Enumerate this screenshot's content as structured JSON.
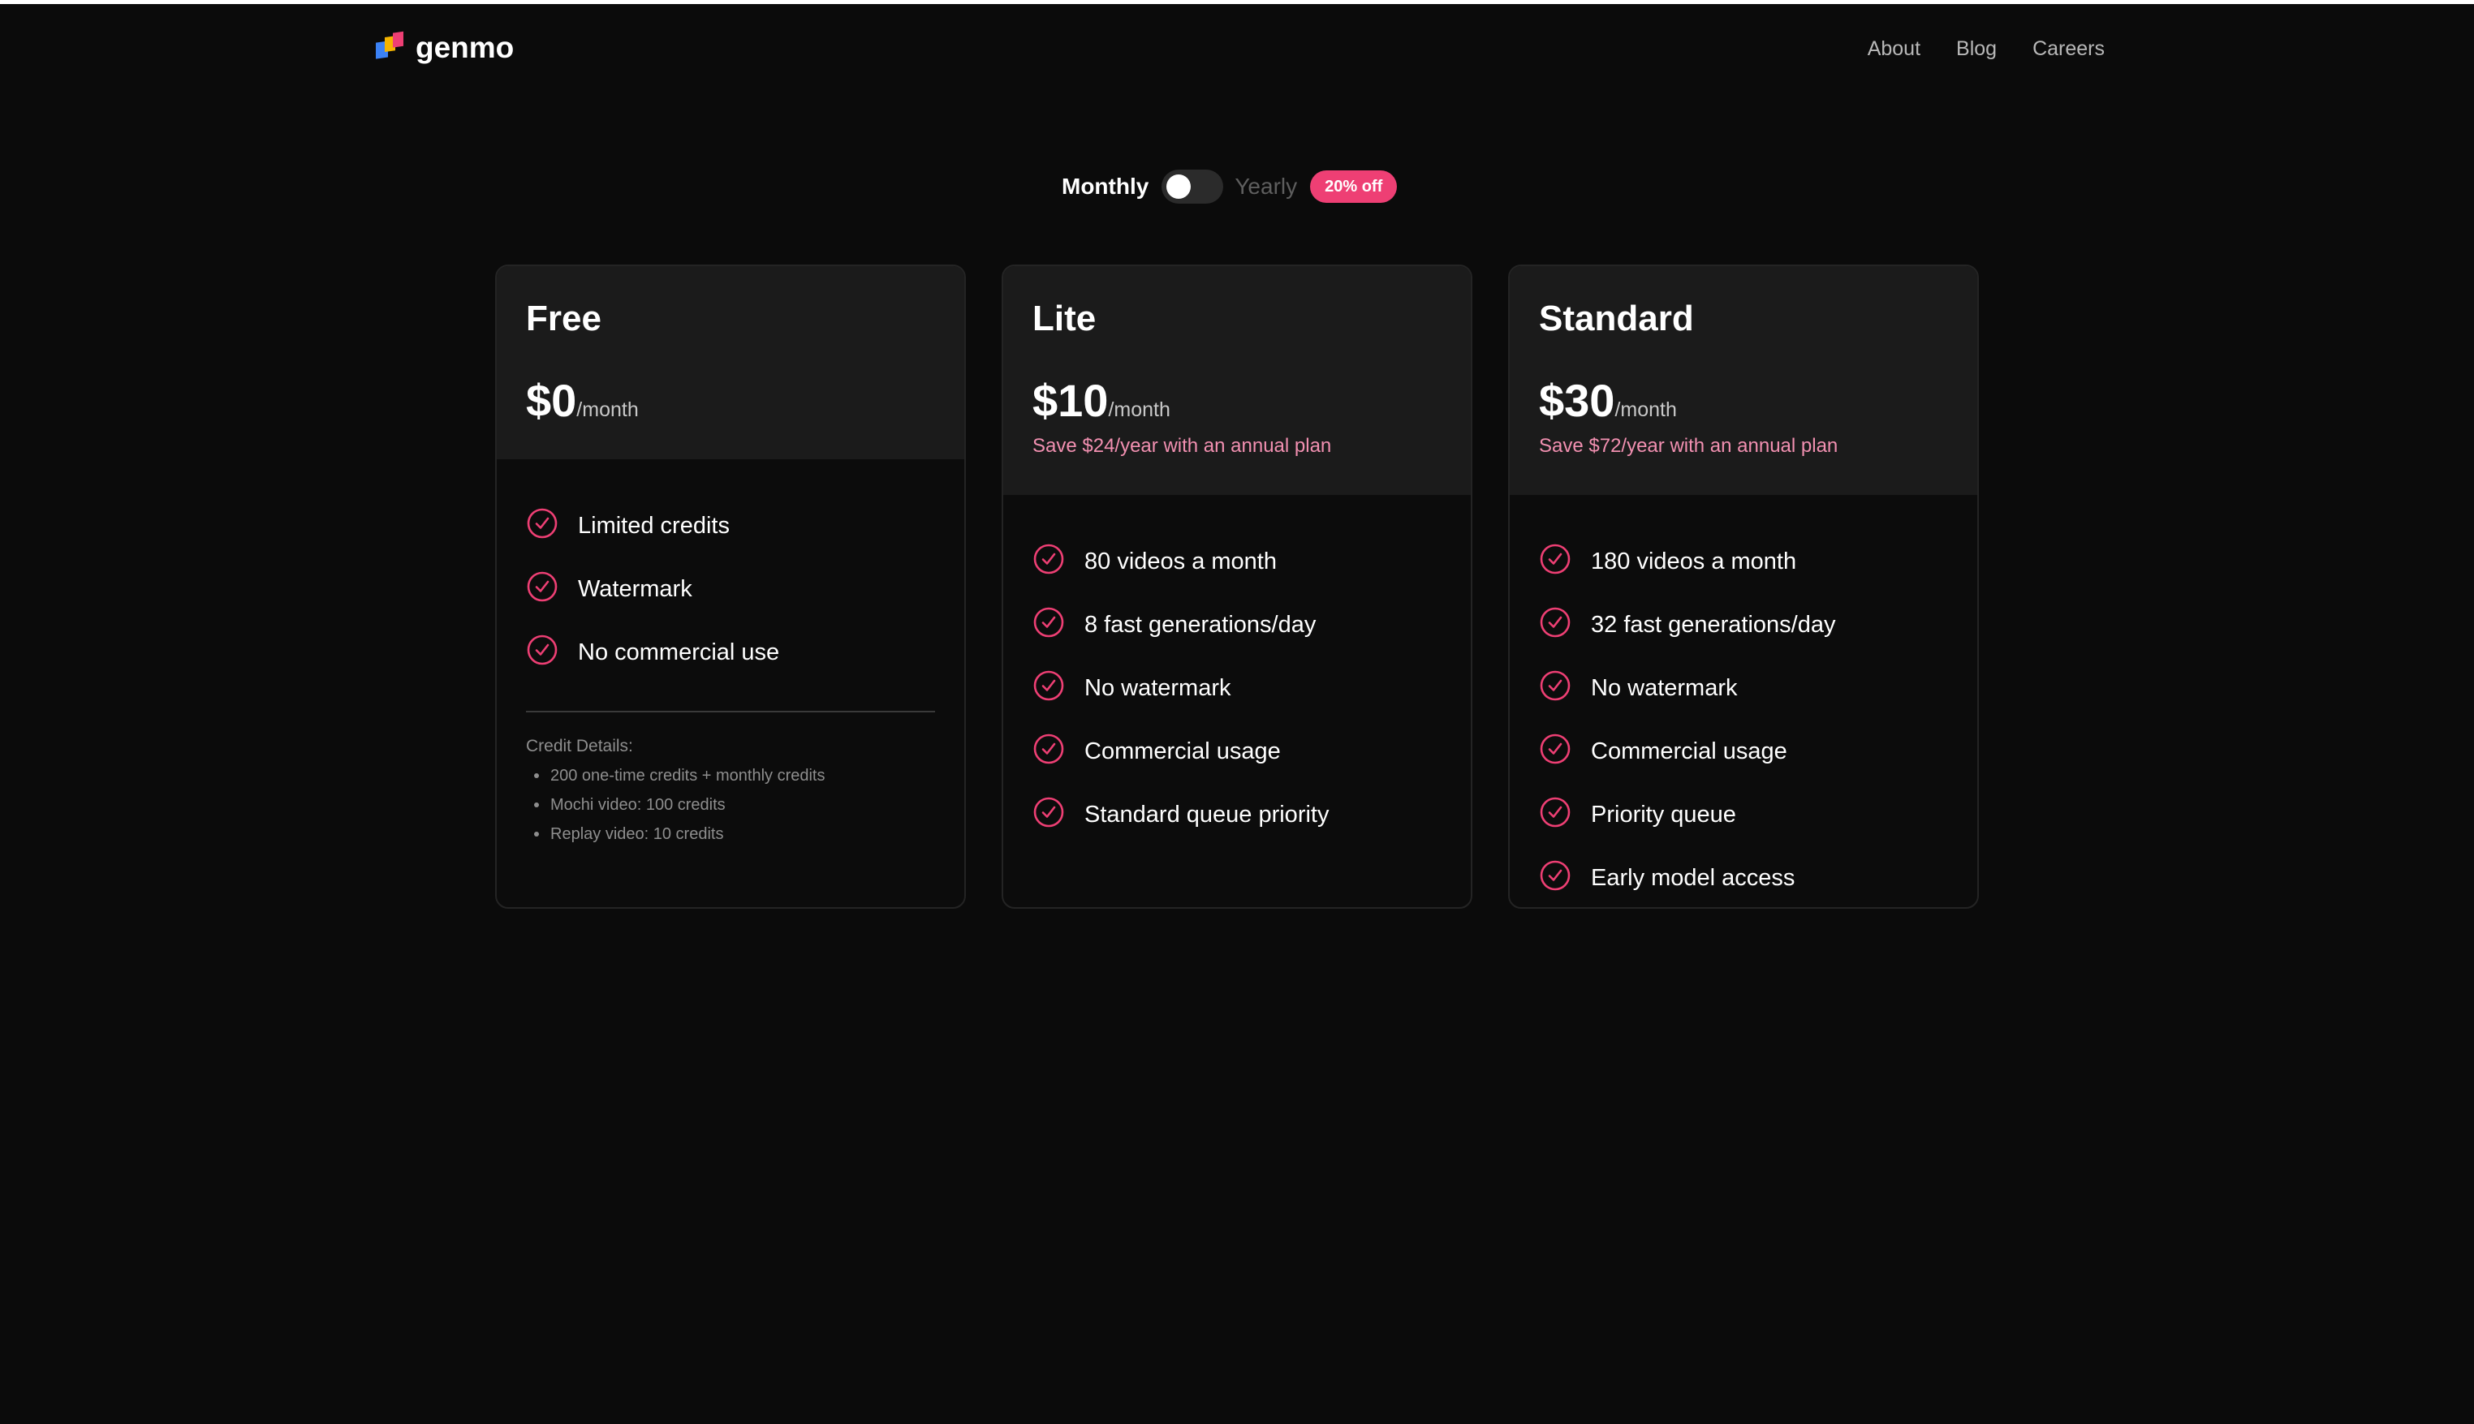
{
  "brand": {
    "name": "genmo"
  },
  "nav": {
    "items": [
      {
        "label": "About"
      },
      {
        "label": "Blog"
      },
      {
        "label": "Careers"
      }
    ]
  },
  "billing": {
    "monthly_label": "Monthly",
    "yearly_label": "Yearly",
    "discount_badge": "20% off",
    "selected": "Monthly"
  },
  "plans": [
    {
      "name": "Free",
      "price": "$0",
      "period": "/month",
      "save_note": "",
      "features": [
        "Limited credits",
        "Watermark",
        "No commercial use"
      ],
      "credit_details": {
        "title": "Credit Details:",
        "items": [
          "200 one-time credits + monthly credits",
          "Mochi video: 100 credits",
          "Replay video: 10 credits"
        ]
      }
    },
    {
      "name": "Lite",
      "price": "$10",
      "period": "/month",
      "save_note": "Save $24/year with an annual plan",
      "features": [
        "80 videos a month",
        "8 fast generations/day",
        "No watermark",
        "Commercial usage",
        "Standard queue priority"
      ]
    },
    {
      "name": "Standard",
      "price": "$30",
      "period": "/month",
      "save_note": "Save $72/year with an annual plan",
      "features": [
        "180 videos a month",
        "32 fast generations/day",
        "No watermark",
        "Commercial usage",
        "Priority queue",
        "Early model access"
      ]
    }
  ],
  "icons": {
    "feature": "check-circle-icon",
    "logo": "genmo-logo-icon"
  },
  "colors": {
    "background": "#0b0b0b",
    "card_header": "#1b1b1b",
    "accent": "#ee3f74",
    "save_text": "#f290b1"
  }
}
